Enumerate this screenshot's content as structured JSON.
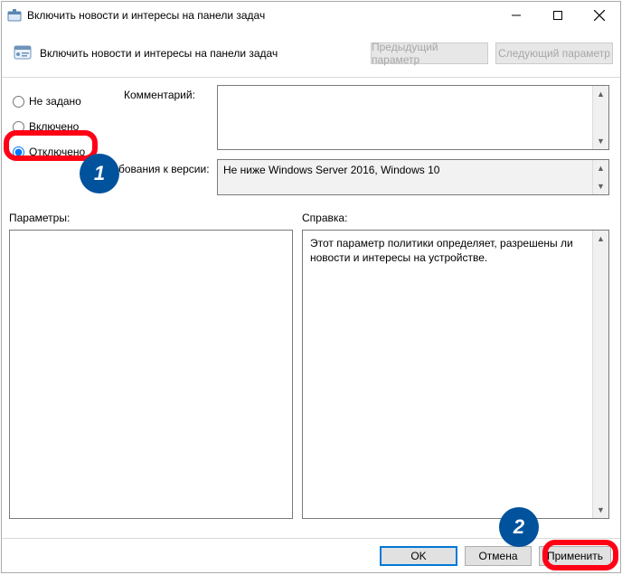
{
  "window": {
    "title": "Включить новости и интересы на панели задач"
  },
  "header": {
    "policy_title": "Включить новости и интересы на панели задач",
    "prev": "Предыдущий параметр",
    "next": "Следующий параметр"
  },
  "state": {
    "not_configured": "Не задано",
    "enabled": "Включено",
    "disabled": "Отключено",
    "selected": "disabled"
  },
  "labels": {
    "comment": "Комментарий:",
    "supported": "бования к версии:",
    "options": "Параметры:",
    "help": "Справка:"
  },
  "fields": {
    "comment": "",
    "supported": "Не ниже Windows Server 2016, Windows 10",
    "help": "Этот параметр политики определяет, разрешены ли новости и интересы на устройстве."
  },
  "buttons": {
    "ok": "OK",
    "cancel": "Отмена",
    "apply": "Применить"
  },
  "annotations": {
    "badge1": "1",
    "badge2": "2"
  }
}
